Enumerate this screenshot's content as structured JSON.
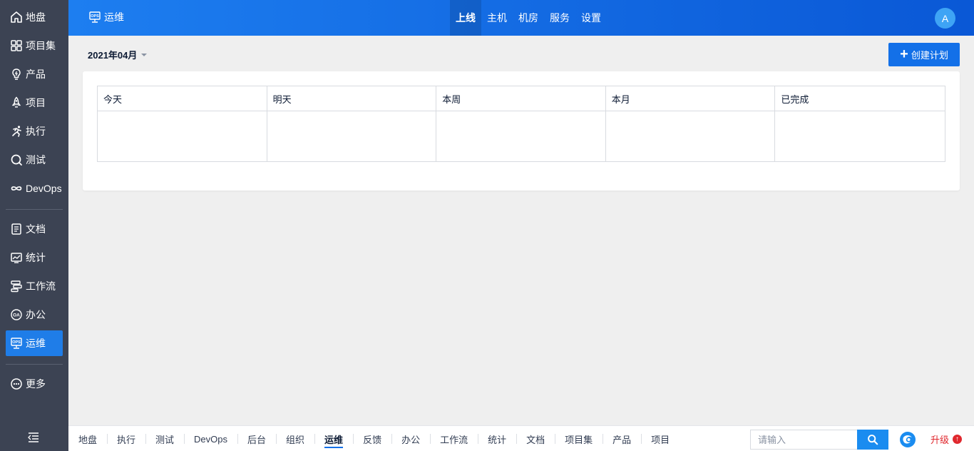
{
  "sidebar": {
    "items": [
      {
        "label": "地盘",
        "icon": "home-icon"
      },
      {
        "label": "项目集",
        "icon": "grid-icon"
      },
      {
        "label": "产品",
        "icon": "lightbulb-icon"
      },
      {
        "label": "项目",
        "icon": "rocket-icon"
      },
      {
        "label": "执行",
        "icon": "run-icon"
      },
      {
        "label": "测试",
        "icon": "bug-search-icon"
      },
      {
        "label": "DevOps",
        "icon": "infinity-icon"
      },
      {
        "label": "文档",
        "icon": "document-icon"
      },
      {
        "label": "统计",
        "icon": "chart-monitor-icon"
      },
      {
        "label": "工作流",
        "icon": "workflow-icon"
      },
      {
        "label": "办公",
        "icon": "oa-icon"
      },
      {
        "label": "运维",
        "icon": "ops-icon"
      },
      {
        "label": "更多",
        "icon": "more-icon"
      }
    ],
    "active": "运维"
  },
  "header": {
    "app_title": "运维",
    "tabs": [
      {
        "label": "上线",
        "active": true
      },
      {
        "label": "主机",
        "active": false
      },
      {
        "label": "机房",
        "active": false
      },
      {
        "label": "服务",
        "active": false
      },
      {
        "label": "设置",
        "active": false
      }
    ],
    "avatar_initial": "A"
  },
  "toolbar": {
    "month": "2021年04月",
    "create_button": "创建计划"
  },
  "board": {
    "columns": [
      "今天",
      "明天",
      "本周",
      "本月",
      "已完成"
    ]
  },
  "bottombar": {
    "nav": [
      {
        "label": "地盘",
        "active": false
      },
      {
        "label": "执行",
        "active": false
      },
      {
        "label": "测试",
        "active": false
      },
      {
        "label": "DevOps",
        "active": false
      },
      {
        "label": "后台",
        "active": false
      },
      {
        "label": "组织",
        "active": false
      },
      {
        "label": "运维",
        "active": true
      },
      {
        "label": "反馈",
        "active": false
      },
      {
        "label": "办公",
        "active": false
      },
      {
        "label": "工作流",
        "active": false
      },
      {
        "label": "统计",
        "active": false
      },
      {
        "label": "文档",
        "active": false
      },
      {
        "label": "项目集",
        "active": false
      },
      {
        "label": "产品",
        "active": false
      },
      {
        "label": "项目",
        "active": false
      }
    ],
    "search_placeholder": "请输入",
    "upgrade_label": "升级"
  },
  "colors": {
    "sidebar_bg": "#3c4353",
    "accent": "#1370e8",
    "upgrade_red": "#e0282e"
  }
}
